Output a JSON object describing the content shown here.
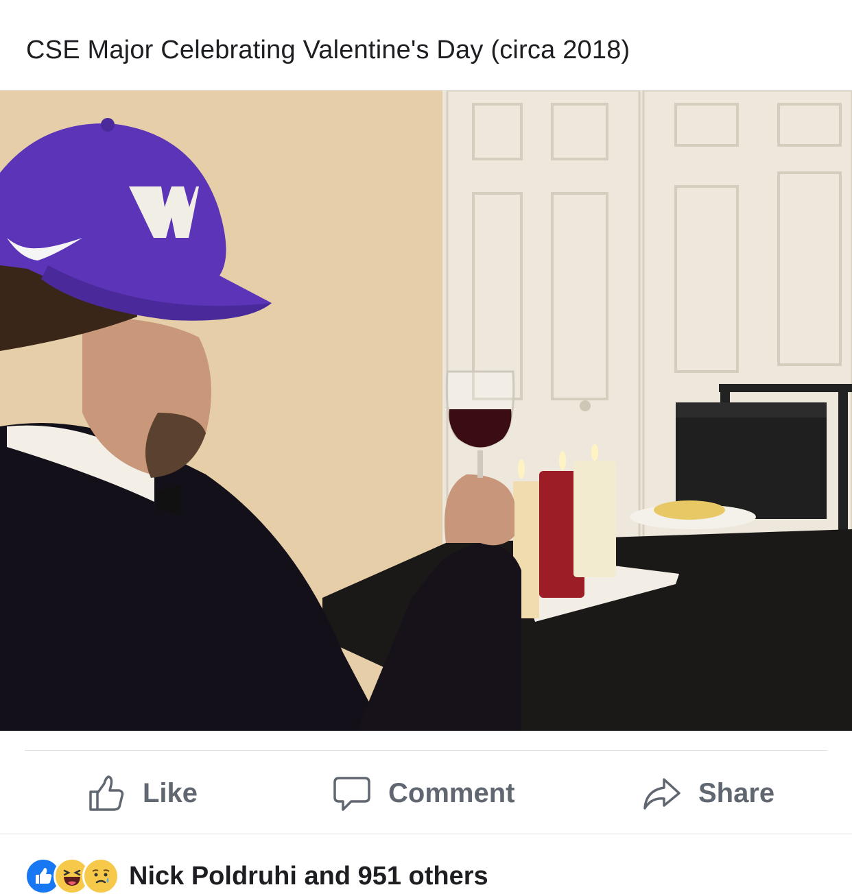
{
  "post": {
    "caption": "CSE Major Celebrating Valentine's Day (circa 2018)"
  },
  "actions": {
    "like_label": "Like",
    "comment_label": "Comment",
    "share_label": "Share"
  },
  "reactions": {
    "icons": [
      "like-icon",
      "haha-icon",
      "sad-icon"
    ],
    "summary": "Nick Poldruhi and 951 others"
  },
  "colors": {
    "action_gray": "#606770",
    "like_blue": "#1877f2",
    "reaction_yellow": "#f7c94a",
    "cap_purple": "#5b34b8"
  }
}
